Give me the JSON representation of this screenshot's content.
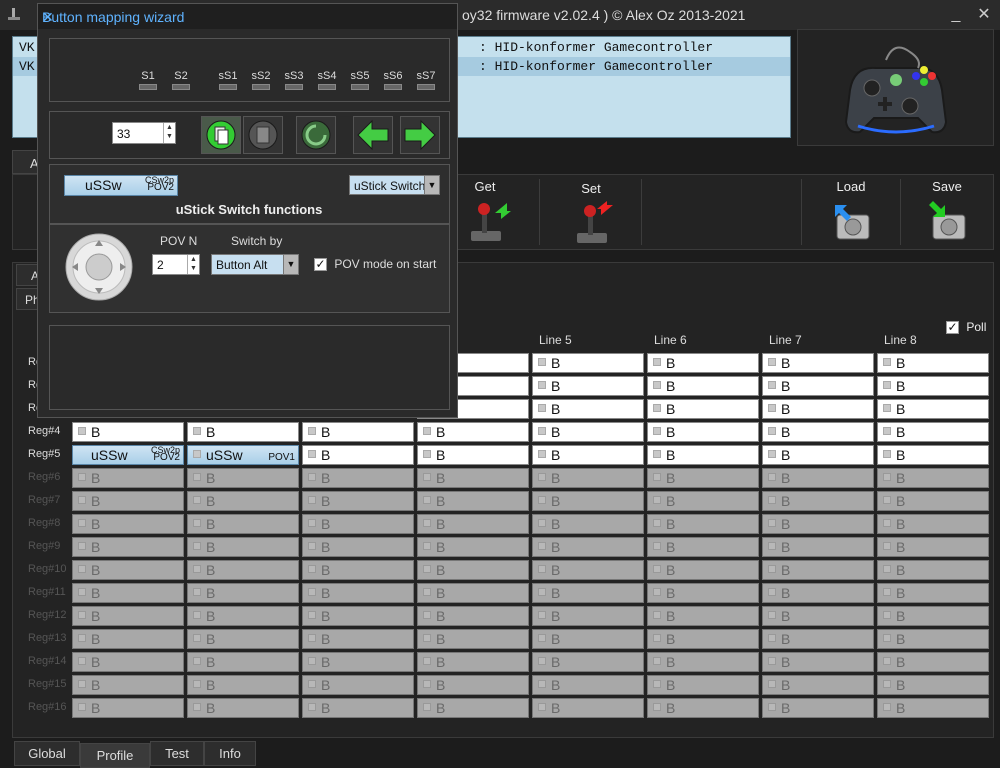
{
  "window": {
    "title": "oy32 firmware v2.02.4 ) © Alex Oz 2013-2021",
    "min": "_",
    "close": "✕"
  },
  "device_list": [
    {
      "prefix": "VK",
      "desc": ": HID-konformer Gamecontroller"
    },
    {
      "prefix": "VK",
      "desc": ": HID-konformer Gamecontroller"
    }
  ],
  "left_stub": {
    "a1": "A",
    "a2": "A",
    "ph": "Ph"
  },
  "toolbar": {
    "get": "Get",
    "set": "Set",
    "load": "Load",
    "save": "Save"
  },
  "grid": {
    "poll_label": "Poll",
    "poll_checked": true,
    "visible_columns": [
      "Line 5",
      "Line 6",
      "Line 7",
      "Line 8"
    ],
    "rows_partial": [
      "Re",
      "Re",
      "Re"
    ],
    "rows": [
      {
        "label": "Reg#4",
        "dim": false,
        "cells": [
          "B",
          "B",
          "B",
          "B",
          "B",
          "B",
          "B",
          "B"
        ]
      },
      {
        "label": "Reg#5",
        "dim": false,
        "cells": [
          "uSSw",
          "uSSw",
          "B",
          "B",
          "B",
          "B",
          "B",
          "B"
        ]
      },
      {
        "label": "Reg#6",
        "dim": true,
        "cells": [
          "B",
          "B",
          "B",
          "B",
          "B",
          "B",
          "B",
          "B"
        ]
      },
      {
        "label": "Reg#7",
        "dim": true,
        "cells": [
          "B",
          "B",
          "B",
          "B",
          "B",
          "B",
          "B",
          "B"
        ]
      },
      {
        "label": "Reg#8",
        "dim": true,
        "cells": [
          "B",
          "B",
          "B",
          "B",
          "B",
          "B",
          "B",
          "B"
        ]
      },
      {
        "label": "Reg#9",
        "dim": true,
        "cells": [
          "B",
          "B",
          "B",
          "B",
          "B",
          "B",
          "B",
          "B"
        ]
      },
      {
        "label": "Reg#10",
        "dim": true,
        "cells": [
          "B",
          "B",
          "B",
          "B",
          "B",
          "B",
          "B",
          "B"
        ]
      },
      {
        "label": "Reg#11",
        "dim": true,
        "cells": [
          "B",
          "B",
          "B",
          "B",
          "B",
          "B",
          "B",
          "B"
        ]
      },
      {
        "label": "Reg#12",
        "dim": true,
        "cells": [
          "B",
          "B",
          "B",
          "B",
          "B",
          "B",
          "B",
          "B"
        ]
      },
      {
        "label": "Reg#13",
        "dim": true,
        "cells": [
          "B",
          "B",
          "B",
          "B",
          "B",
          "B",
          "B",
          "B"
        ]
      },
      {
        "label": "Reg#14",
        "dim": true,
        "cells": [
          "B",
          "B",
          "B",
          "B",
          "B",
          "B",
          "B",
          "B"
        ]
      },
      {
        "label": "Reg#15",
        "dim": true,
        "cells": [
          "B",
          "B",
          "B",
          "B",
          "B",
          "B",
          "B",
          "B"
        ]
      },
      {
        "label": "Reg#16",
        "dim": true,
        "cells": [
          "B",
          "B",
          "B",
          "B",
          "B",
          "B",
          "B",
          "B"
        ]
      }
    ],
    "reg5_cell1_sup_top": "CSw2p",
    "reg5_cell1_sup_bottom": "POV2",
    "reg5_cell2_sup": "POV1"
  },
  "tabs": [
    {
      "label": "Global"
    },
    {
      "label": "Profile",
      "active": true
    },
    {
      "label": "Test"
    },
    {
      "label": "Info"
    }
  ],
  "wizard": {
    "title": "Button mapping wizard",
    "close": "✕",
    "switch_labels": [
      "S1",
      "S2",
      "sS1",
      "sS2",
      "sS3",
      "sS4",
      "sS5",
      "sS6",
      "sS7"
    ],
    "number_value": "33",
    "function_chip": {
      "label": "uSSw",
      "sup_top": "CSw2p",
      "sup_bottom": "POV2"
    },
    "type_select": "uStick Switch",
    "section_title": "uStick Switch functions",
    "pov_label": "POV N",
    "pov_value": "2",
    "switch_by_label": "Switch by",
    "switch_by_value": "Button Alt",
    "pov_mode_label": "POV mode on start",
    "pov_mode_checked": true
  }
}
